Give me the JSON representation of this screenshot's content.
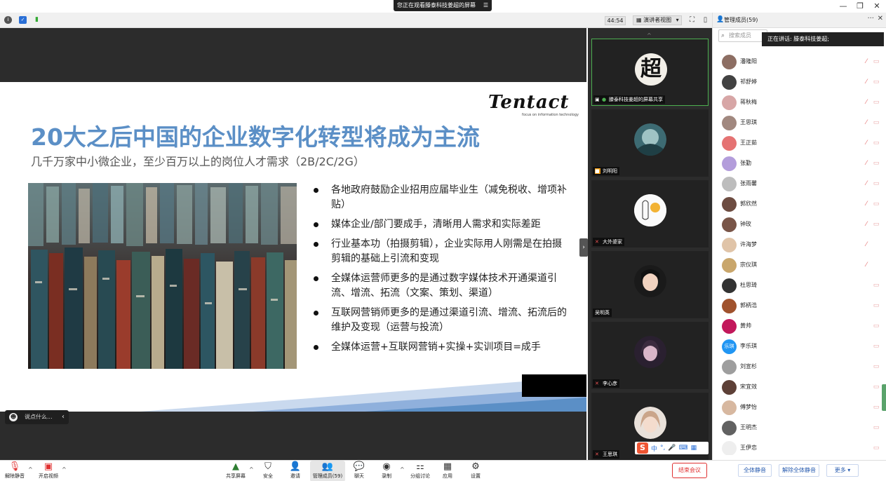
{
  "window": {
    "share_banner": "您正在观看滕泰科技姜超的屏幕",
    "share_pin": "☰",
    "minimize": "—",
    "restore": "❐",
    "close": "✕"
  },
  "toolbar": {
    "timer": "44:54",
    "view_mode": "演讲者视图",
    "view_mode_caret": "▾"
  },
  "slide": {
    "logo": "Tentact",
    "logo_sub": "focus on information technology",
    "title": "20大之后中国的企业数字化转型将成为主流",
    "subtitle": "几千万家中小微企业，至少百万以上的岗位人才需求（2B/2C/2G）",
    "bullets": [
      "各地政府鼓励企业招用应届毕业生（减免税收、增项补贴）",
      "媒体企业/部门要成手，清晰用人需求和实际差距",
      "行业基本功（拍摄剪辑），企业实际用人刚需是在拍摄剪辑的基础上引流和变现",
      "全媒体运营师更多的是通过数字媒体技术开通渠道引流、增流、拓流（文案、策划、渠道）",
      "互联网营销师更多的是通过渠道引流、增流、拓流后的维护及变现（运营与投流）",
      "全媒体运营+互联网营销+实操+实训项目=成手"
    ]
  },
  "chat": {
    "placeholder": "说点什么...",
    "collapse": "‹"
  },
  "video_strip": {
    "tiles": [
      {
        "name": "滕泰科技姜超的屏幕共享",
        "avatar_text": "超"
      },
      {
        "name": "刘明阳"
      },
      {
        "name": "大外婆家"
      },
      {
        "name": "吴明英"
      },
      {
        "name": "李心彦"
      },
      {
        "name": "王思琪"
      }
    ],
    "ime": [
      "S",
      "中",
      "°,",
      "🎤",
      "⌨",
      "▦"
    ]
  },
  "panel": {
    "title": "管理成员(59)",
    "more": "···",
    "close": "✕",
    "search_placeholder": "搜索成员",
    "speaking": "正在讲话: 滕泰科技姜超;",
    "members": [
      {
        "name": "潘隆阳",
        "color": "#8d6e63"
      },
      {
        "name": "祁舒婷",
        "color": "#424242"
      },
      {
        "name": "蒋秋梅",
        "color": "#d7a6a6"
      },
      {
        "name": "王思琪",
        "color": "#a1887f"
      },
      {
        "name": "王正茹",
        "color": "#e57373"
      },
      {
        "name": "张勤",
        "color": "#b39ddb"
      },
      {
        "name": "张雨馨",
        "color": "#bdbdbd"
      },
      {
        "name": "郭欣然",
        "color": "#6d4c41"
      },
      {
        "name": "钟玫",
        "color": "#795548"
      },
      {
        "name": "许海梦",
        "color": "#e0c4a8"
      },
      {
        "name": "宗仪琪",
        "color": "#c9a66b"
      },
      {
        "name": "杜思琦",
        "color": "#333333"
      },
      {
        "name": "郭柄浩",
        "color": "#a0522d"
      },
      {
        "name": "黄帅",
        "color": "#c2185b"
      },
      {
        "name": "李乐琪",
        "color": "#2196f3",
        "avatar_text": "乐琪"
      },
      {
        "name": "刘宣杉",
        "color": "#9e9e9e"
      },
      {
        "name": "宋宜效",
        "color": "#5d4037"
      },
      {
        "name": "傅梦怡",
        "color": "#d7b8a0"
      },
      {
        "name": "王明杰",
        "color": "#616161"
      },
      {
        "name": "王伊恋",
        "color": "#eeeeee"
      }
    ]
  },
  "bottom": {
    "unmute": "解除静音",
    "start_video": "开启视频",
    "share_screen": "共享屏幕",
    "security": "安全",
    "invite": "邀请",
    "manage_members": "管理成员(59)",
    "chat": "聊天",
    "record": "录制",
    "breakout": "分组讨论",
    "apps": "应用",
    "settings": "设置",
    "end_meeting": "结束会议",
    "mute_all": "全体静音",
    "unmute_all": "解除全体静音",
    "more": "更多 ▾",
    "caret": "^"
  },
  "colors": {
    "title_blue": "#5b8fc6",
    "end_red": "#e03131",
    "active_green": "#4caf50"
  }
}
